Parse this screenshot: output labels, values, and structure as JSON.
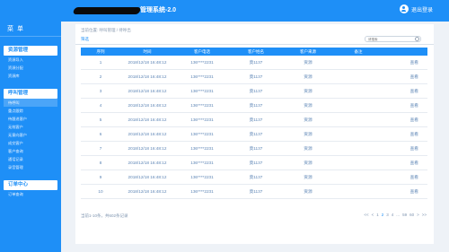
{
  "header": {
    "title": "管理系统-2.0",
    "logout": "退出登录"
  },
  "sidebar": {
    "menu_title": "菜 单",
    "groups": [
      {
        "title": "资源管理",
        "items": [
          "资源导入",
          "资源分配",
          "资源库"
        ]
      },
      {
        "title": "呼叫管理",
        "items": [
          "待呼叫",
          "重点跟踪",
          "待跟进客户",
          "无效客户",
          "无意向客户",
          "成交客户",
          "客户查询",
          "通话记录",
          "录音管理"
        ]
      },
      {
        "title": "订单中心",
        "items": [
          "订单查询"
        ]
      }
    ]
  },
  "breadcrumb": "当前位置: 呼叫管理 / 待呼出",
  "tab": "筛选",
  "search": {
    "placeholder": "请搜索"
  },
  "table": {
    "columns": [
      "序列",
      "时间",
      "客户电话",
      "客户姓名",
      "客户来源",
      "备注",
      ""
    ],
    "rows": [
      {
        "idx": "1",
        "time": "2018/12/18 16:48:12",
        "phone": "136****2231",
        "name": "莫1137",
        "source": "资源",
        "note": "",
        "action": "查看"
      },
      {
        "idx": "2",
        "time": "2018/12/18 16:48:12",
        "phone": "136****2231",
        "name": "莫1137",
        "source": "资源",
        "note": "",
        "action": "查看"
      },
      {
        "idx": "3",
        "time": "2018/12/18 16:48:12",
        "phone": "136****2231",
        "name": "莫1137",
        "source": "资源",
        "note": "",
        "action": "查看"
      },
      {
        "idx": "4",
        "time": "2018/12/18 16:48:12",
        "phone": "136****2231",
        "name": "莫1137",
        "source": "资源",
        "note": "",
        "action": "查看"
      },
      {
        "idx": "5",
        "time": "2018/12/18 16:48:12",
        "phone": "136****2231",
        "name": "莫1137",
        "source": "资源",
        "note": "",
        "action": "查看"
      },
      {
        "idx": "6",
        "time": "2018/12/18 16:48:12",
        "phone": "136****2231",
        "name": "莫1137",
        "source": "资源",
        "note": "",
        "action": "查看"
      },
      {
        "idx": "7",
        "time": "2018/12/18 16:48:12",
        "phone": "136****2231",
        "name": "莫1137",
        "source": "资源",
        "note": "",
        "action": "查看"
      },
      {
        "idx": "8",
        "time": "2018/12/18 16:48:12",
        "phone": "136****2231",
        "name": "莫1137",
        "source": "资源",
        "note": "",
        "action": "查看"
      },
      {
        "idx": "9",
        "time": "2018/12/18 16:48:12",
        "phone": "136****2231",
        "name": "莫1137",
        "source": "资源",
        "note": "",
        "action": "查看"
      },
      {
        "idx": "10",
        "time": "2018/12/18 16:48:12",
        "phone": "136****2231",
        "name": "莫1137",
        "source": "资源",
        "note": "",
        "action": "查看"
      }
    ]
  },
  "footer": {
    "info": "当前1-10条，共602条记录"
  },
  "pager": {
    "first": "<<",
    "prev": "<",
    "pages": [
      "1",
      "2",
      "3",
      "4"
    ],
    "current": "2",
    "ellipsis": "...",
    "last_pages": [
      "59",
      "60"
    ],
    "next": ">",
    "last": ">>"
  }
}
